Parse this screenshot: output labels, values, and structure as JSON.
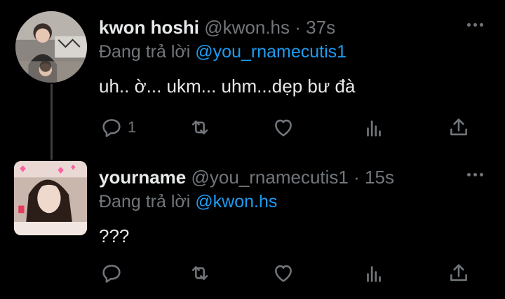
{
  "tweets": [
    {
      "display_name": "kwon hoshi",
      "handle": "@kwon.hs",
      "dot": "·",
      "time": "37s",
      "reply_prefix": "Đang trả lời",
      "reply_to": "@you_rnamecutis1",
      "text": "uh.. ờ... ukm... uhm...dẹp bư đà",
      "reply_count": "1"
    },
    {
      "display_name": "yourname",
      "handle": "@you_rnamecutis1",
      "dot": "·",
      "time": "15s",
      "reply_prefix": "Đang trả lời",
      "reply_to": "@kwon.hs",
      "text": "???",
      "reply_count": ""
    }
  ],
  "icons": {
    "more": "more-horizontal-icon",
    "reply": "reply-icon",
    "retweet": "retweet-icon",
    "like": "heart-icon",
    "views": "views-chart-icon",
    "share": "share-icon"
  },
  "colors": {
    "background": "#000000",
    "text_primary": "#e7e9ea",
    "text_secondary": "#71767b",
    "accent": "#1d9bf0"
  }
}
